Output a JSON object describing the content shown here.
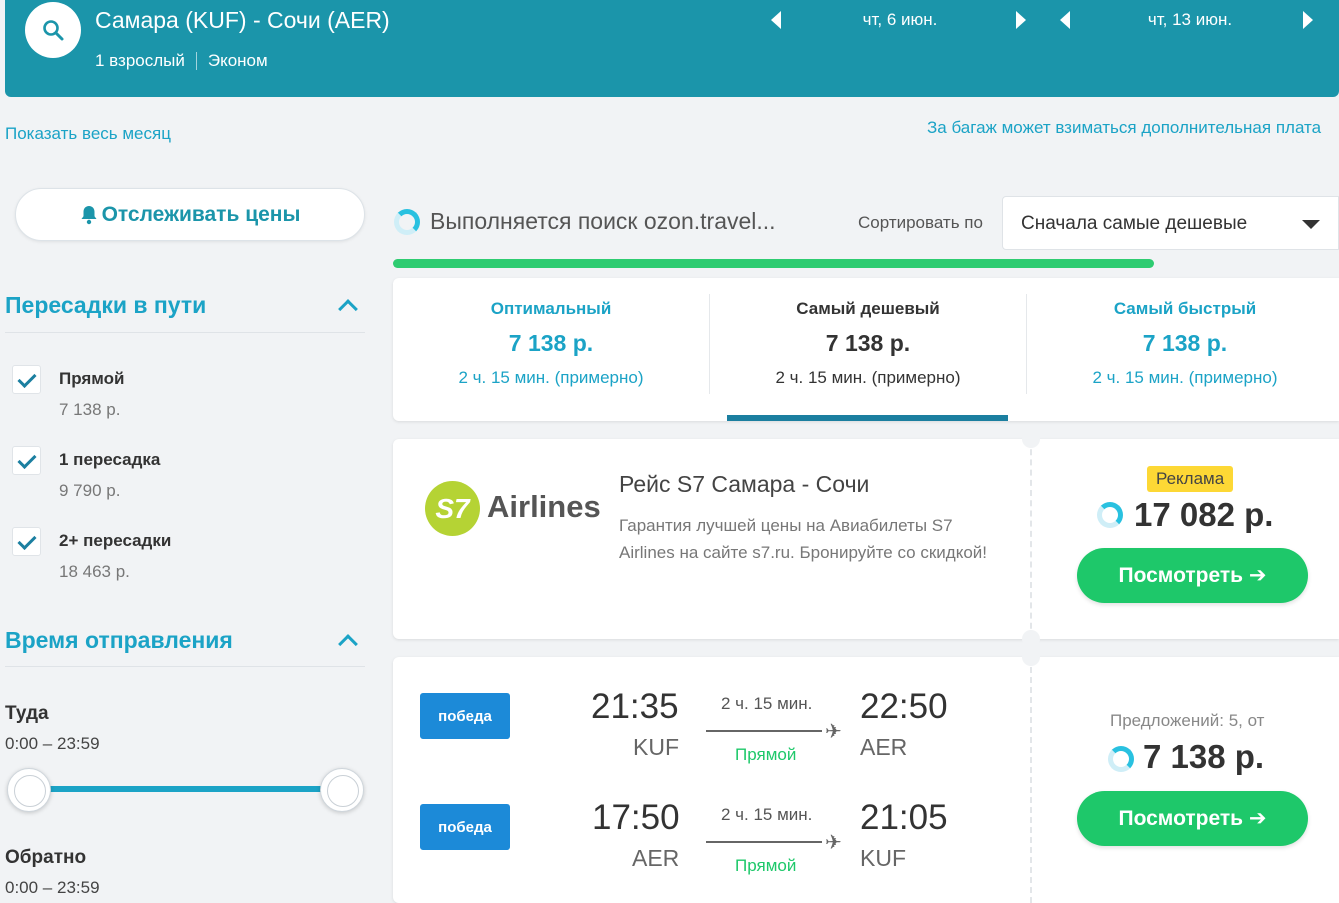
{
  "header": {
    "route": "Самара (KUF) - Сочи (AER)",
    "passengers": "1 взрослый",
    "cabin": "Эконом",
    "date_out": "чт, 6 июн.",
    "date_back": "чт, 13 июн."
  },
  "links": {
    "show_month": "Показать весь месяц",
    "baggage_note": "За багаж может взиматься дополнительная плата"
  },
  "track_button": "Отслеживать цены",
  "filters": {
    "stops_title": "Пересадки в пути",
    "stops": [
      {
        "label": "Прямой",
        "price": "7 138 р.",
        "checked": true
      },
      {
        "label": "1 пересадка",
        "price": "9 790 р.",
        "checked": true
      },
      {
        "label": "2+ пересадки",
        "price": "18 463 р.",
        "checked": true
      }
    ],
    "departure_title": "Время отправления",
    "outbound_label": "Туда",
    "outbound_range": "0:00 – 23:59",
    "return_label": "Обратно",
    "return_range": "0:00 – 23:59"
  },
  "search": {
    "status": "Выполняется поиск ozon.travel...",
    "progress_fraction": 0.8
  },
  "sort": {
    "label": "Сортировать по",
    "selected": "Сначала самые дешевые"
  },
  "tabs": [
    {
      "title": "Оптимальный",
      "price": "7 138 р.",
      "duration": "2 ч. 15 мин. (примерно)"
    },
    {
      "title": "Самый дешевый",
      "price": "7 138 р.",
      "duration": "2 ч. 15 мин. (примерно)",
      "active": true
    },
    {
      "title": "Самый быстрый",
      "price": "7 138 р.",
      "duration": "2 ч. 15 мин. (примерно)"
    }
  ],
  "ad": {
    "logo_mark": "S7",
    "logo_text": "Airlines",
    "title": "Рейс S7 Самара - Сочи",
    "description": "Гарантия лучшей цены на Авиабилеты S7 Airlines на сайте s7.ru. Бронируйте со скидкой!",
    "badge": "Реклама",
    "price": "17 082 р.",
    "button": "Посмотреть ➔"
  },
  "offer": {
    "legs": [
      {
        "airline": "победа",
        "dep_time": "21:35",
        "dep_code": "KUF",
        "duration": "2 ч. 15 мин.",
        "stops": "Прямой",
        "arr_time": "22:50",
        "arr_code": "AER"
      },
      {
        "airline": "победа",
        "dep_time": "17:50",
        "dep_code": "AER",
        "duration": "2 ч. 15 мин.",
        "stops": "Прямой",
        "arr_time": "21:05",
        "arr_code": "KUF"
      }
    ],
    "offers_count": "Предложений: 5, от",
    "price": "7 138 р.",
    "button": "Посмотреть ➔"
  },
  "colors": {
    "header": "#1b95aa",
    "accent": "#1ba3c6",
    "green": "#1ec86a",
    "badge": "#fdd835"
  }
}
